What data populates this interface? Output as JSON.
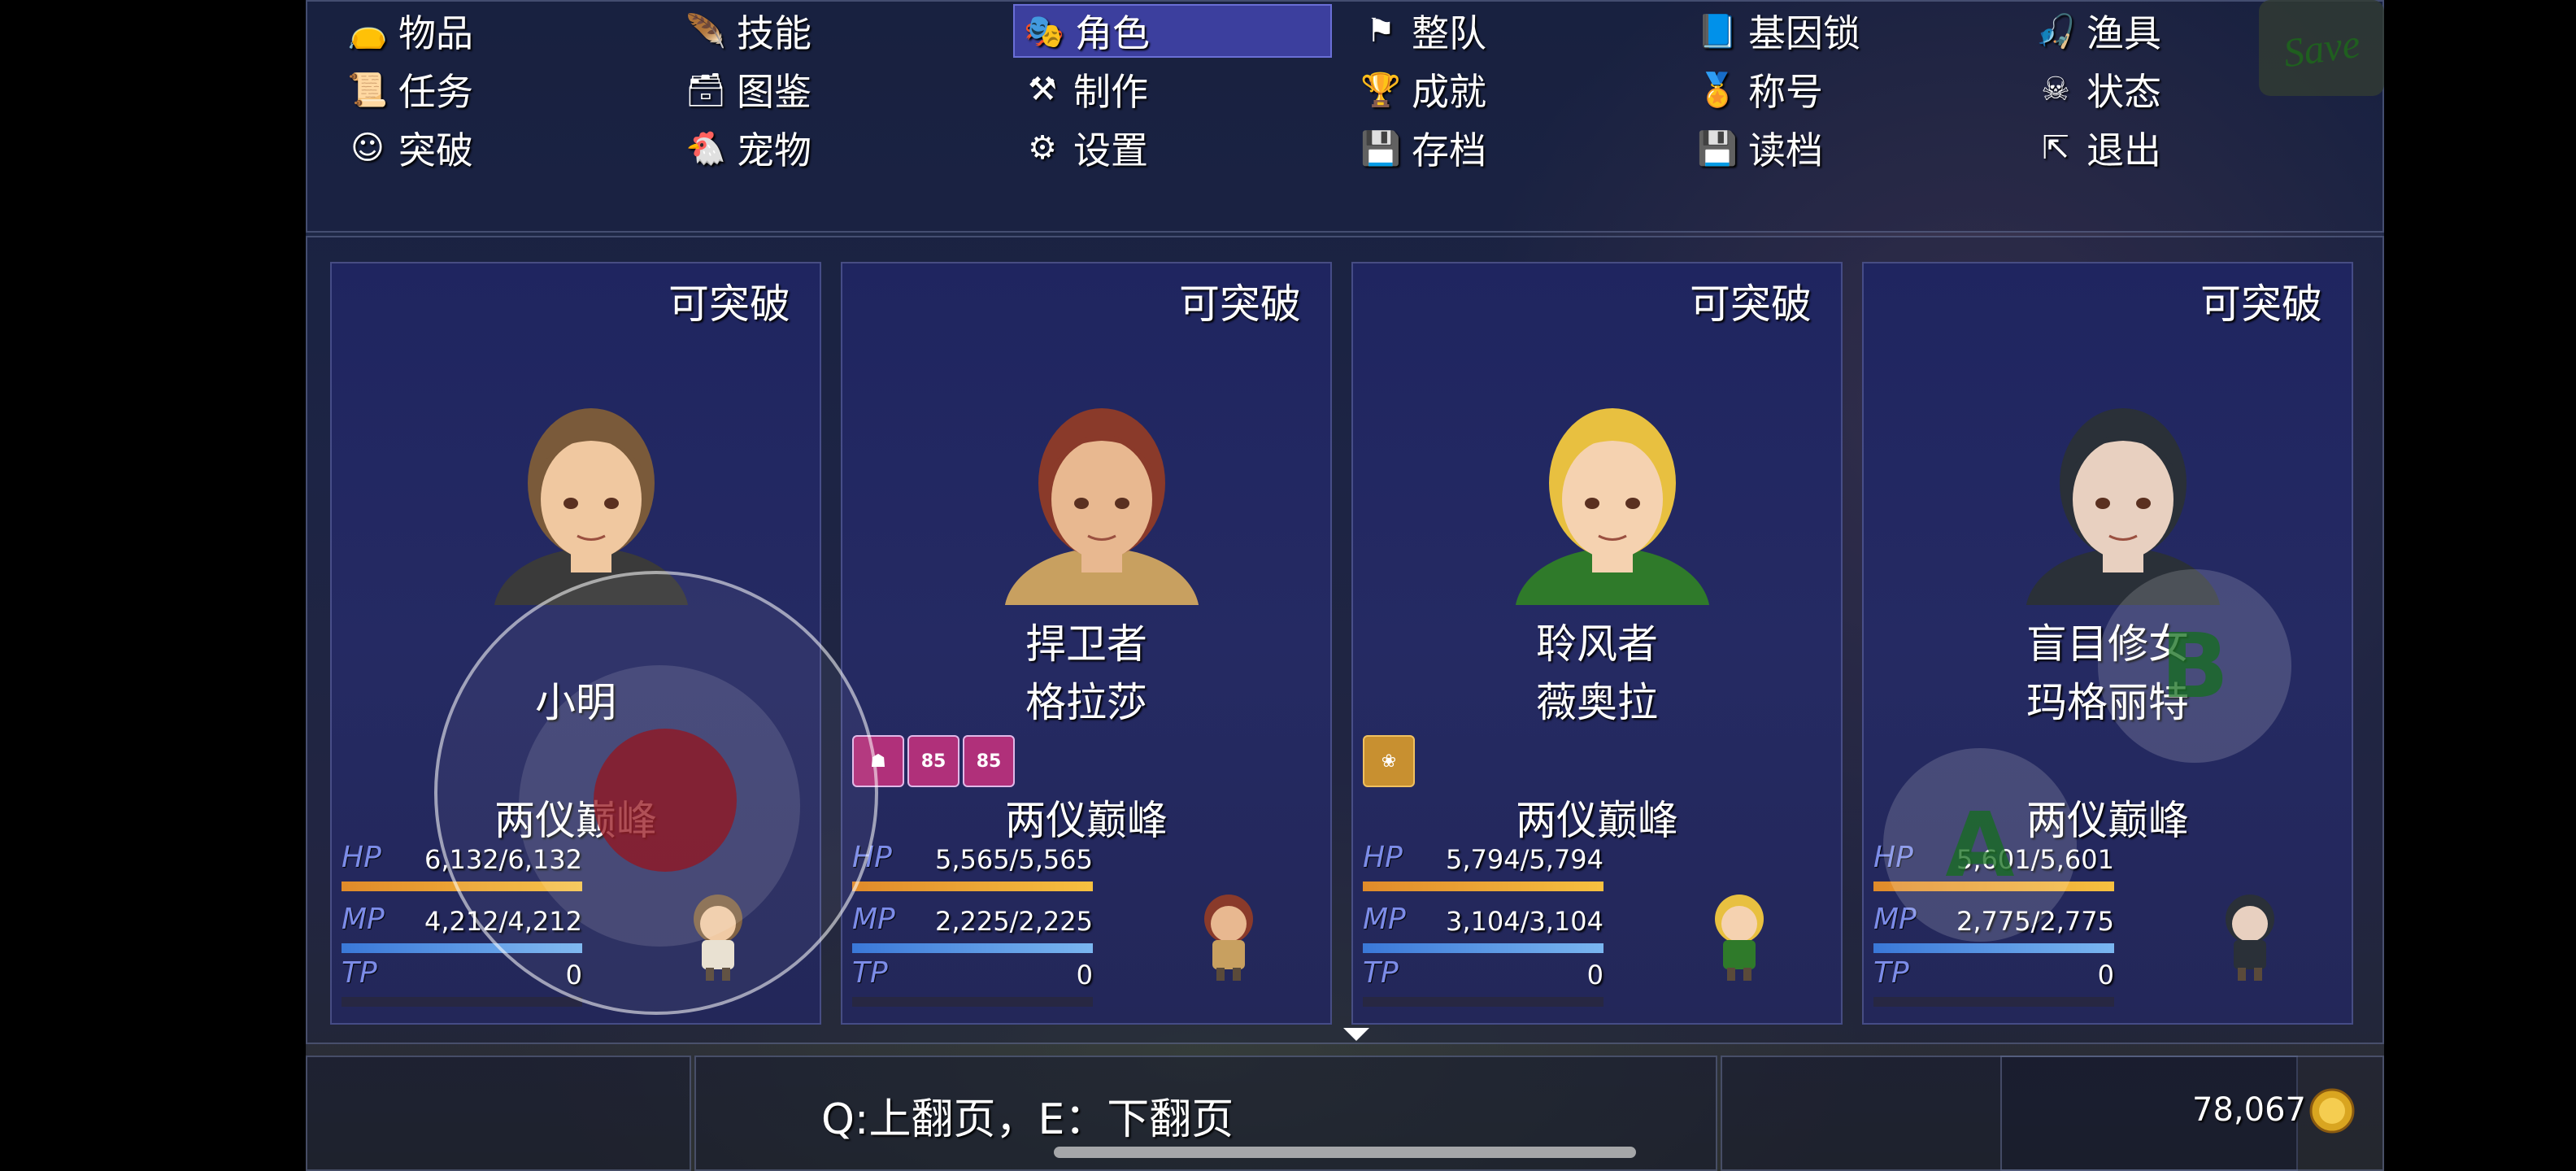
{
  "save_label": "Save",
  "menu": [
    {
      "label": "物品",
      "icon": "bag-icon"
    },
    {
      "label": "技能",
      "icon": "skill-feather-icon"
    },
    {
      "label": "角色",
      "icon": "masks-icon",
      "active": true
    },
    {
      "label": "整队",
      "icon": "flag-icon"
    },
    {
      "label": "基因锁",
      "icon": "book-icon"
    },
    {
      "label": "渔具",
      "icon": "fishing-rod-icon"
    },
    {
      "label": "任务",
      "icon": "scroll-icon"
    },
    {
      "label": "图鉴",
      "icon": "chest-icon"
    },
    {
      "label": "制作",
      "icon": "anvil-icon"
    },
    {
      "label": "成就",
      "icon": "trophy-icon"
    },
    {
      "label": "称号",
      "icon": "medal-icon"
    },
    {
      "label": "状态",
      "icon": "gas-mask-icon"
    },
    {
      "label": "突破",
      "icon": "face-icon"
    },
    {
      "label": "宠物",
      "icon": "chicken-icon"
    },
    {
      "label": "设置",
      "icon": "gear-icon"
    },
    {
      "label": "存档",
      "icon": "floppy-save-icon"
    },
    {
      "label": "读档",
      "icon": "floppy-load-icon"
    },
    {
      "label": "退出",
      "icon": "exit-icon"
    }
  ],
  "characters": [
    {
      "breakthrough": "可突破",
      "class": "",
      "name": "小明",
      "rank": "两仪巅峰",
      "hp": "6,132/6,132",
      "mp": "4,212/4,212",
      "tp": "0",
      "hp_ratio": 1,
      "mp_ratio": 1,
      "tp_ratio": 0,
      "states": [],
      "hair": "#7a5a3a",
      "skin": "#f0c8a0",
      "clothes": "#3a3a3a"
    },
    {
      "breakthrough": "可突破",
      "class": "捍卫者",
      "name": "格拉莎",
      "rank": "两仪巅峰",
      "hp": "5,565/5,565",
      "mp": "2,225/2,225",
      "tp": "0",
      "hp_ratio": 1,
      "mp_ratio": 1,
      "tp_ratio": 0,
      "states": [
        {
          "icon": "muscle-state-icon",
          "text": ""
        },
        {
          "icon": "buff-state-icon",
          "text": "85"
        },
        {
          "icon": "face-state-icon",
          "text": "85"
        }
      ],
      "hair": "#8a3a2a",
      "skin": "#e8b890",
      "clothes": "#c8a060"
    },
    {
      "breakthrough": "可突破",
      "class": "聆风者",
      "name": "薇奥拉",
      "rank": "两仪巅峰",
      "hp": "5,794/5,794",
      "mp": "3,104/3,104",
      "tp": "0",
      "hp_ratio": 1,
      "mp_ratio": 1,
      "tp_ratio": 0,
      "states": [
        {
          "icon": "lotus-state-icon",
          "text": ""
        }
      ],
      "hair": "#e8c040",
      "skin": "#f5d2b0",
      "clothes": "#2f7a2a"
    },
    {
      "breakthrough": "可突破",
      "class": "盲目修女",
      "name": "玛格丽特",
      "rank": "两仪巅峰",
      "hp": "5,601/5,601",
      "mp": "2,775/2,775",
      "tp": "0",
      "hp_ratio": 1,
      "mp_ratio": 1,
      "tp_ratio": 0,
      "states": [],
      "hair": "#2a3038",
      "skin": "#e8d0c0",
      "clothes": "#2a3038"
    }
  ],
  "stat_labels": {
    "hp": "HP",
    "mp": "MP",
    "tp": "TP"
  },
  "help_text": "Q:上翻页，E：下翻页",
  "gold": "78,067",
  "colors": {
    "hp_start": "#e08a2a",
    "hp_end": "#f6c040",
    "mp_start": "#3a78d8",
    "mp_end": "#7ab6f0",
    "active_menu": "#3c3f9e"
  },
  "touch": {
    "a": "A",
    "b": "B"
  }
}
